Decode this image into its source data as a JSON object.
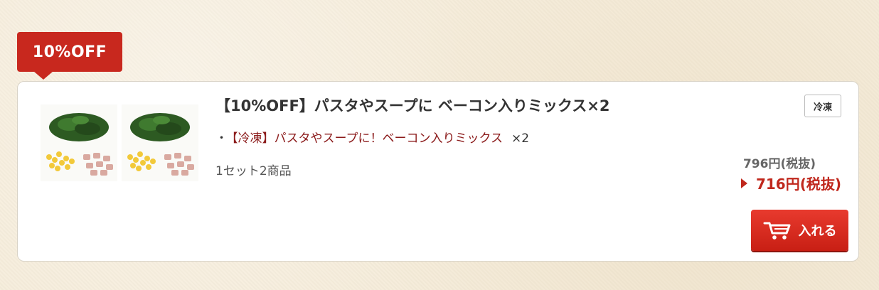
{
  "badge": {
    "label": "10%OFF"
  },
  "product": {
    "title": "【10%OFF】パスタやスープに ベーコン入りミックス×2",
    "storage_tag": "冷凍",
    "items": [
      {
        "bullet": "・",
        "name": "【冷凍】パスタやスープに！ベーコン入りミックス",
        "qty": "×2"
      }
    ],
    "set_info": "1セット2商品",
    "price_original": "796円(税抜)",
    "price_sale": "716円(税抜)",
    "cart_button_label": "入れる"
  },
  "icons": {
    "thumbnail_1": "product-image-icon",
    "thumbnail_2": "product-image-icon",
    "cart": "cart-icon",
    "sale_arrow": "triangle-right-icon"
  },
  "colors": {
    "accent_red": "#c8281e",
    "item_name": "#8b1a1a",
    "background": "#f5ecd9"
  }
}
